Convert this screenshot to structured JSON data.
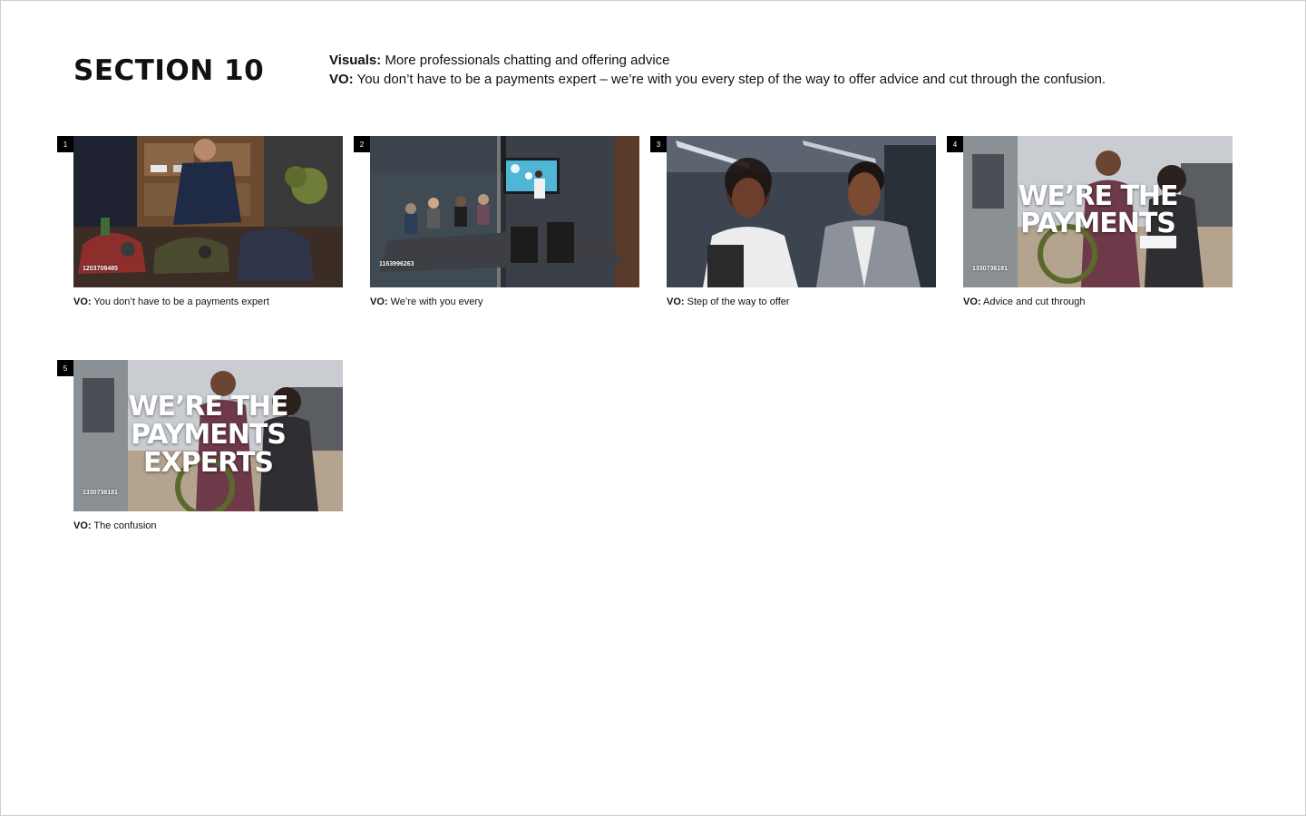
{
  "section": {
    "title": "SECTION 10"
  },
  "notes": {
    "visuals_label": "Visuals:",
    "visuals_text": "More professionals chatting and offering advice",
    "vo_label": "VO:",
    "vo_text": "You don’t have to be a payments expert – we’re with you every step of the way to offer advice and cut through the confusion."
  },
  "frames": [
    {
      "number": "1",
      "clip_id": "1203708485",
      "vo_label": "VO:",
      "caption": "You don’t have to be a payments expert",
      "overlay": ""
    },
    {
      "number": "2",
      "clip_id": "1163996263",
      "vo_label": "VO:",
      "caption": "We’re with you every",
      "overlay": ""
    },
    {
      "number": "3",
      "clip_id": "",
      "vo_label": "VO:",
      "caption": "Step of the way to offer",
      "overlay": ""
    },
    {
      "number": "4",
      "clip_id": "1330736181",
      "vo_label": "VO:",
      "caption": "Advice and cut through",
      "overlay_line1": "WE’RE THE",
      "overlay_line2": "PAYMENTS"
    },
    {
      "number": "5",
      "clip_id": "1330736181",
      "vo_label": "VO:",
      "caption": "The confusion",
      "overlay_line1": "WE’RE THE",
      "overlay_line2": "PAYMENTS",
      "overlay_line3": "EXPERTS"
    }
  ]
}
